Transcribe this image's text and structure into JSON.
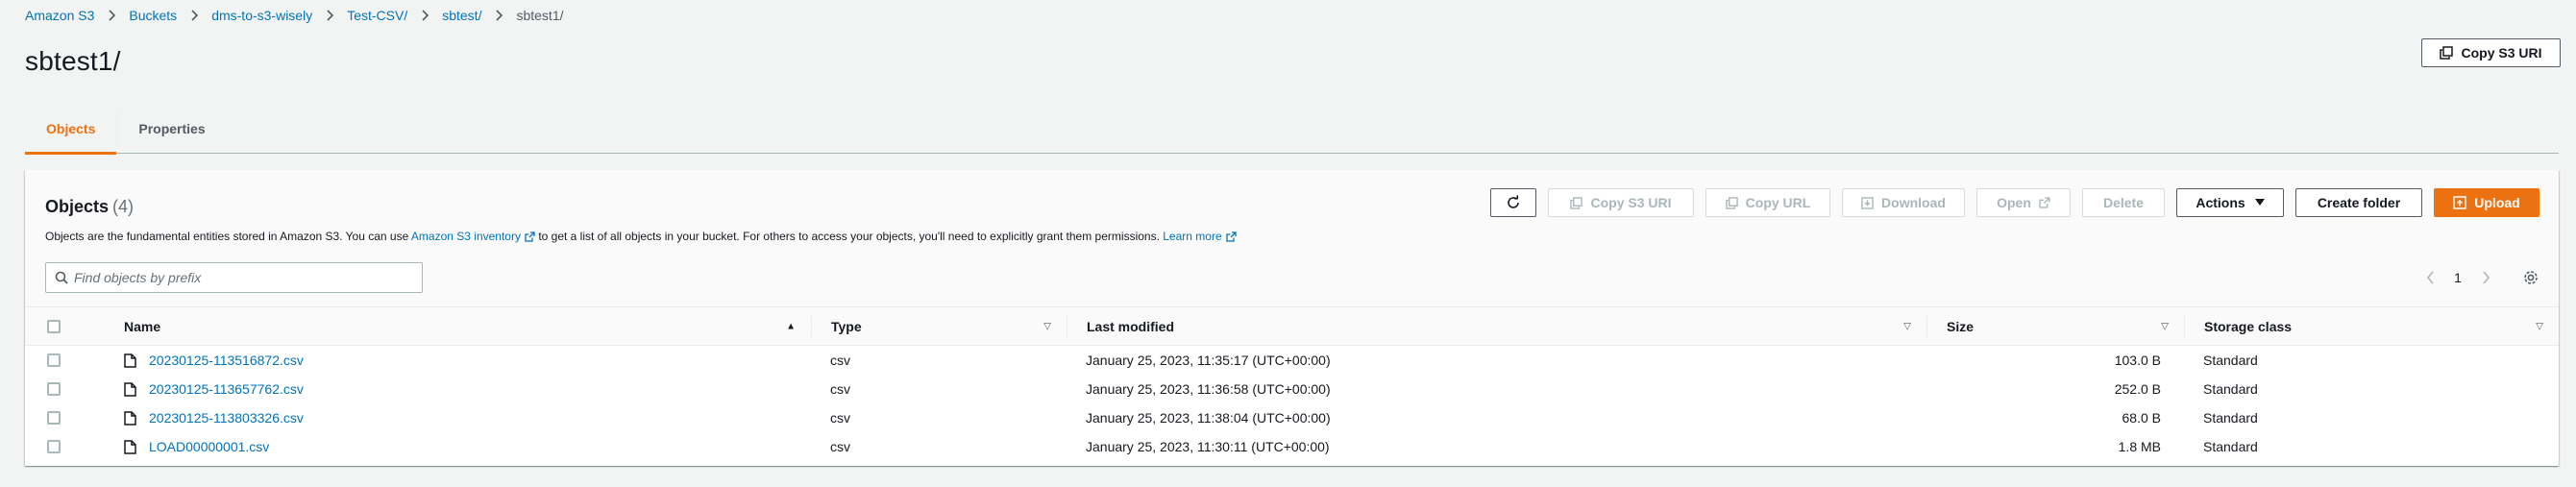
{
  "breadcrumb": [
    {
      "label": "Amazon S3",
      "link": true
    },
    {
      "label": "Buckets",
      "link": true
    },
    {
      "label": "dms-to-s3-wisely",
      "link": true
    },
    {
      "label": "Test-CSV/",
      "link": true
    },
    {
      "label": "sbtest/",
      "link": true
    },
    {
      "label": "sbtest1/",
      "link": false
    }
  ],
  "page": {
    "title": "sbtest1/",
    "copy_uri_label": "Copy S3 URI"
  },
  "tabs": [
    {
      "label": "Objects",
      "active": true
    },
    {
      "label": "Properties",
      "active": false
    }
  ],
  "objects_panel": {
    "title": "Objects",
    "count": "(4)",
    "desc_before": "Objects are the fundamental entities stored in Amazon S3. You can use ",
    "desc_link1": "Amazon S3 inventory",
    "desc_middle": " to get a list of all objects in your bucket. For others to access your objects, you'll need to explicitly grant them permissions. ",
    "desc_link2": "Learn more",
    "actions": {
      "copy_s3_uri": "Copy S3 URI",
      "copy_url": "Copy URL",
      "download": "Download",
      "open": "Open",
      "delete": "Delete",
      "actions": "Actions",
      "create_folder": "Create folder",
      "upload": "Upload"
    },
    "search_placeholder": "Find objects by prefix",
    "page_number": "1"
  },
  "table": {
    "columns": [
      "Name",
      "Type",
      "Last modified",
      "Size",
      "Storage class"
    ],
    "rows": [
      {
        "name": "20230125-113516872.csv",
        "type": "csv",
        "modified": "January 25, 2023, 11:35:17 (UTC+00:00)",
        "size": "103.0 B",
        "class": "Standard"
      },
      {
        "name": "20230125-113657762.csv",
        "type": "csv",
        "modified": "January 25, 2023, 11:36:58 (UTC+00:00)",
        "size": "252.0 B",
        "class": "Standard"
      },
      {
        "name": "20230125-113803326.csv",
        "type": "csv",
        "modified": "January 25, 2023, 11:38:04 (UTC+00:00)",
        "size": "68.0 B",
        "class": "Standard"
      },
      {
        "name": "LOAD00000001.csv",
        "type": "csv",
        "modified": "January 25, 2023, 11:30:11 (UTC+00:00)",
        "size": "1.8 MB",
        "class": "Standard"
      }
    ]
  },
  "colors": {
    "accent": "#ec7211",
    "link": "#0073bb",
    "text": "#16191f",
    "muted": "#545b64"
  }
}
